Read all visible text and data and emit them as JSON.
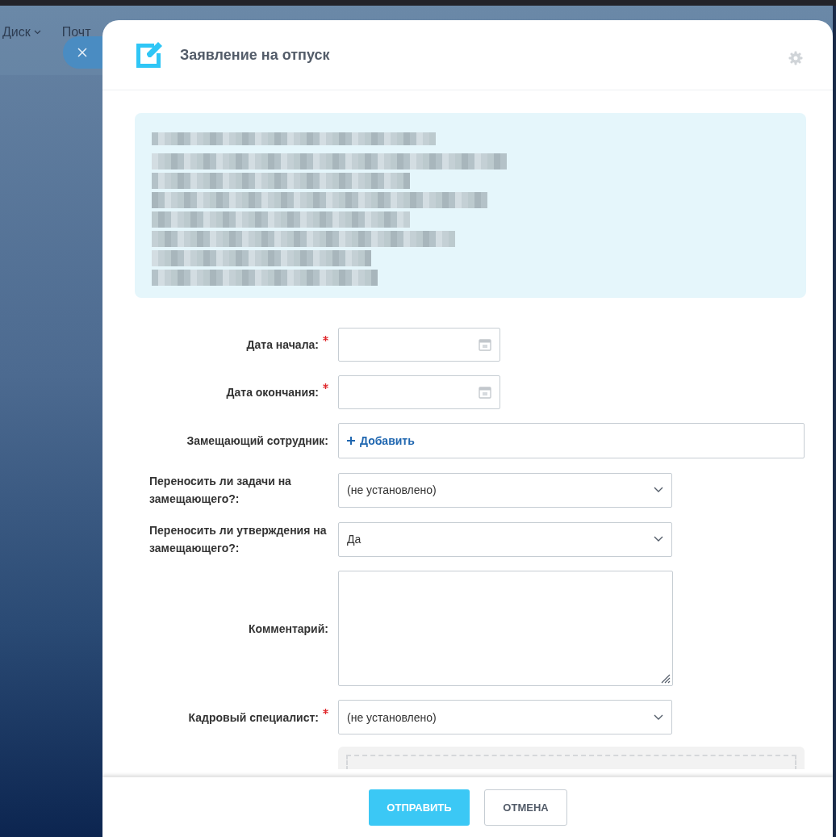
{
  "backdrop": {
    "nav_items": [
      {
        "label": "Диск",
        "kind": "menu"
      },
      {
        "label": "Почт",
        "kind": "link"
      }
    ]
  },
  "dialog": {
    "title": "Заявление на отпуск",
    "fields": [
      {
        "label": "Дата начала:",
        "required": true,
        "kind": "date"
      },
      {
        "label": "Дата окончания:",
        "required": true,
        "kind": "date"
      },
      {
        "label": "Замещающий сотрудник:",
        "required": false,
        "kind": "people",
        "value": "Добавить"
      },
      {
        "label": "Переносить ли задачи на замещающего?:",
        "required": false,
        "kind": "select",
        "value": "(не установлено)"
      },
      {
        "label": "Переносить ли утверждения на замещающего?:",
        "required": false,
        "kind": "select",
        "value": "Да"
      },
      {
        "label": "Комментарий:",
        "required": false,
        "kind": "textarea"
      },
      {
        "label": "Кадровый специалист:",
        "required": true,
        "kind": "select",
        "value": "(не установлено)"
      },
      {
        "kind": "dropzone"
      }
    ],
    "buttons": [
      {
        "label": "ОТПРАВИТЬ",
        "primary": true
      },
      {
        "label": "ОТМЕНА",
        "primary": false
      }
    ]
  }
}
